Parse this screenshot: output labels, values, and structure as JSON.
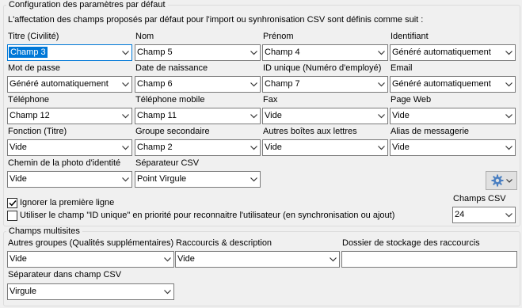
{
  "default_group": {
    "title": "Configuration des paramètres par défaut",
    "intro": "L'affectation des champs proposés par défaut pour l'import ou synhronisation CSV sont définis comme suit :",
    "fields": [
      {
        "label": "Titre (Civilité)",
        "value": "Champ 3"
      },
      {
        "label": "Nom",
        "value": "Champ 5"
      },
      {
        "label": "Prénom",
        "value": "Champ 4"
      },
      {
        "label": "Identifiant",
        "value": "Généré automatiquement"
      },
      {
        "label": "Mot de passe",
        "value": "Généré automatiquement"
      },
      {
        "label": "Date de naissance",
        "value": "Champ 6"
      },
      {
        "label": "ID unique (Numéro d'employé)",
        "value": "Champ 7"
      },
      {
        "label": "Email",
        "value": "Généré automatiquement"
      },
      {
        "label": "Téléphone",
        "value": "Champ 12"
      },
      {
        "label": "Téléphone mobile",
        "value": "Champ 11"
      },
      {
        "label": "Fax",
        "value": "Vide"
      },
      {
        "label": "Page Web",
        "value": "Vide"
      },
      {
        "label": "Fonction (Titre)",
        "value": "Vide"
      },
      {
        "label": "Groupe secondaire",
        "value": "Champ 2"
      },
      {
        "label": "Autres boîtes aux lettres",
        "value": "Vide"
      },
      {
        "label": "Alias de messagerie",
        "value": "Vide"
      },
      {
        "label": "Chemin de la photo d'identité",
        "value": "Vide"
      },
      {
        "label": "Séparateur CSV",
        "value": "Point Virgule"
      }
    ],
    "ignore_first_line": {
      "label": "Ignorer la première ligne",
      "checked": true
    },
    "unique_id_priority": {
      "label": "Utiliser le champ \"ID unique\" en priorité pour reconnaitre l'utilisateur (en synchronisation ou ajout)",
      "checked": false
    },
    "csv_fields": {
      "label": "Champs CSV",
      "value": "24"
    },
    "settings_button": {
      "icon": "gear-icon",
      "dropdown_icon": "chevron-down-icon"
    }
  },
  "multi_group": {
    "title": "Champs multisites",
    "other_groups": {
      "label": "Autres groupes (Qualités supplémentaires)",
      "value": "Vide"
    },
    "shortcuts": {
      "label": "Raccourcis & description",
      "value": "Vide"
    },
    "storage_folder": {
      "label": "Dossier de stockage des raccourcis",
      "value": ""
    },
    "separator": {
      "label": "Séparateur dans champ CSV",
      "value": "Virgule"
    }
  },
  "colors": {
    "accent": "#0078d7",
    "background": "#f0f0f0",
    "gear_blue": "#4a7fc1"
  }
}
